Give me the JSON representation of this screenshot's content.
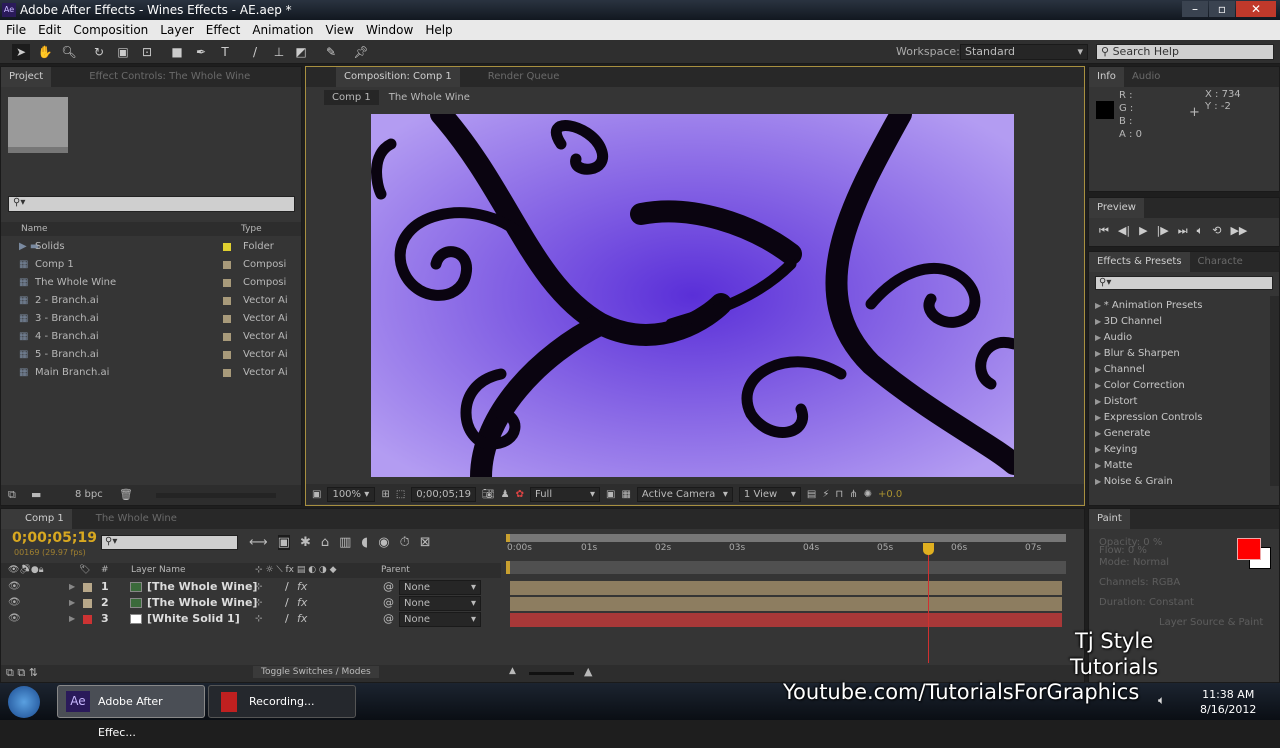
{
  "window": {
    "title": "Adobe After Effects - Wines Effects - AE.aep *",
    "app_icon": "Ae"
  },
  "menu": [
    "File",
    "Edit",
    "Composition",
    "Layer",
    "Effect",
    "Animation",
    "View",
    "Window",
    "Help"
  ],
  "workspace": {
    "label": "Workspace:",
    "value": "Standard"
  },
  "search_help": "Search Help",
  "project": {
    "tabs": [
      "Project",
      "Effect Controls: The Whole Wine"
    ],
    "columns": [
      "Name",
      "Type"
    ],
    "items": [
      {
        "name": "Solids",
        "type": "Folder",
        "color": "#e0d030"
      },
      {
        "name": "Comp 1",
        "type": "Composi",
        "color": "#a89a7a"
      },
      {
        "name": "The Whole Wine",
        "type": "Composi",
        "color": "#a89a7a"
      },
      {
        "name": "2 - Branch.ai",
        "type": "Vector Ai",
        "color": "#a89a7a"
      },
      {
        "name": "3 - Branch.ai",
        "type": "Vector Ai",
        "color": "#a89a7a"
      },
      {
        "name": "4 - Branch.ai",
        "type": "Vector Ai",
        "color": "#a89a7a"
      },
      {
        "name": "5 - Branch.ai",
        "type": "Vector Ai",
        "color": "#a89a7a"
      },
      {
        "name": "Main Branch.ai",
        "type": "Vector Ai",
        "color": "#a89a7a"
      }
    ],
    "bpc": "8 bpc"
  },
  "composition": {
    "tabs": [
      "Composition: Comp 1",
      "Render Queue"
    ],
    "breadcrumbs": [
      "Comp 1",
      "The Whole Wine"
    ],
    "zoom": "100%",
    "timecode": "0;00;05;19",
    "resolution": "Full",
    "camera": "Active Camera",
    "views": "1 View",
    "exposure": "+0.0"
  },
  "info": {
    "tabs": [
      "Info",
      "Audio"
    ],
    "r": "R :",
    "g": "G :",
    "b": "B :",
    "a": "A : 0",
    "x": "X : 734",
    "y": "Y : -2"
  },
  "preview": {
    "title": "Preview"
  },
  "effects": {
    "tabs": [
      "Effects & Presets",
      "Characte"
    ],
    "items": [
      "* Animation Presets",
      "3D Channel",
      "Audio",
      "Blur & Sharpen",
      "Channel",
      "Color Correction",
      "Distort",
      "Expression Controls",
      "Generate",
      "Keying",
      "Matte",
      "Noise & Grain"
    ]
  },
  "timeline": {
    "tabs": [
      "Comp 1",
      "The Whole Wine"
    ],
    "timecode": "0;00;05;19",
    "frames": "00169 (29.97 fps)",
    "columns": {
      "num": "#",
      "name": "Layer Name",
      "parent": "Parent"
    },
    "ruler": [
      "0:00s",
      "01s",
      "02s",
      "03s",
      "04s",
      "05s",
      "06s",
      "07s"
    ],
    "current_time_s": 5.63,
    "layers": [
      {
        "num": "1",
        "name": "[The Whole Wine]",
        "parent": "None",
        "label": "#b8a88a",
        "bar": "#8d7d60"
      },
      {
        "num": "2",
        "name": "[The Whole Wine]",
        "parent": "None",
        "label": "#b8a88a",
        "bar": "#8d7d60"
      },
      {
        "num": "3",
        "name": "[White Solid 1]",
        "parent": "None",
        "label": "#cc3333",
        "bar": "#a83838"
      }
    ],
    "toggle": "Toggle Switches / Modes"
  },
  "paint": {
    "title": "Paint",
    "opacity": "Opacity: 0 %",
    "flow": "Flow: 0 %",
    "mode": "Mode:",
    "mode_value": "Normal",
    "channels": "Channels:",
    "channels_value": "RGBA",
    "duration": "Duration:",
    "duration_value": "Constant",
    "erase": "Layer Source & Paint",
    "fg": "#ff0000",
    "bg": "#ffffff"
  },
  "taskbar": {
    "items": [
      "Adobe After Effec...",
      "Recording..."
    ],
    "time": "11:38 AM",
    "date": "8/16/2012"
  },
  "watermark": {
    "line1": "Tj Style",
    "line2": "Tutorials",
    "line3": "Youtube.com/TutorialsForGraphics"
  }
}
